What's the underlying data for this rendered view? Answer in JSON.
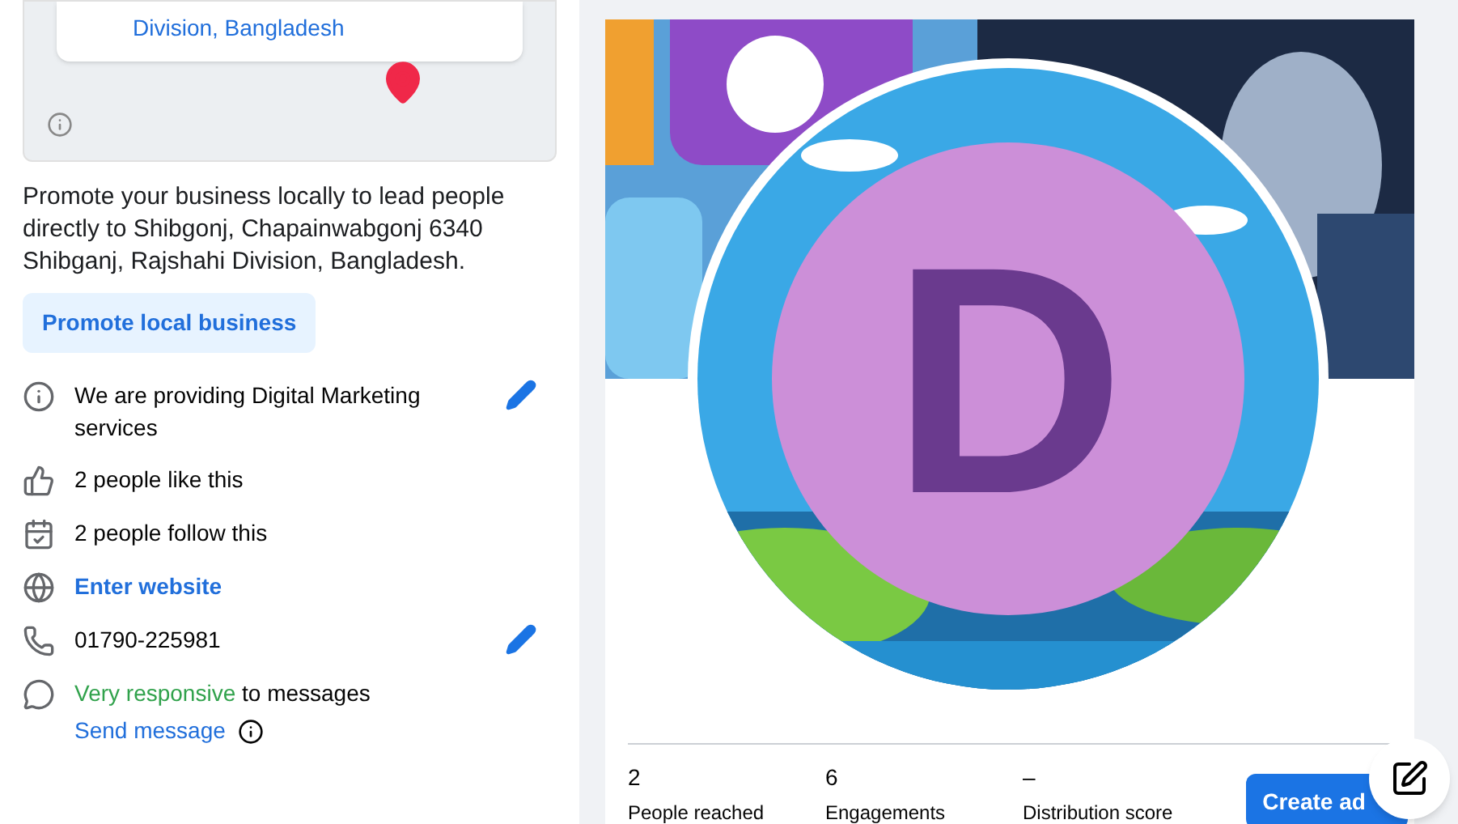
{
  "map": {
    "address_tail": "Division, Bangladesh"
  },
  "promote": {
    "text": "Promote your business locally to lead people directly to Shibgonj, Chapainwabgonj 6340 Shibganj, Rajshahi Division, Bangladesh.",
    "button": "Promote local business"
  },
  "about": [
    {
      "kind": "info",
      "text": "We are providing Digital Marketing services",
      "editable": true
    },
    {
      "kind": "like",
      "text": "2 people like this",
      "editable": false
    },
    {
      "kind": "follow",
      "text": "2 people follow this",
      "editable": false
    },
    {
      "kind": "website",
      "text": "Enter website",
      "editable": false
    },
    {
      "kind": "phone",
      "text": "01790-225981",
      "editable": true
    },
    {
      "kind": "messages",
      "highlight": "Very responsive",
      "text": "to messages",
      "link": "Send message",
      "editable": false
    }
  ],
  "profile": {
    "initial": "D"
  },
  "stats": [
    {
      "value": "2",
      "label": "People reached"
    },
    {
      "value": "6",
      "label": "Engagements"
    },
    {
      "value": "–",
      "label": "Distribution score"
    }
  ],
  "create_ad": "Create ad"
}
